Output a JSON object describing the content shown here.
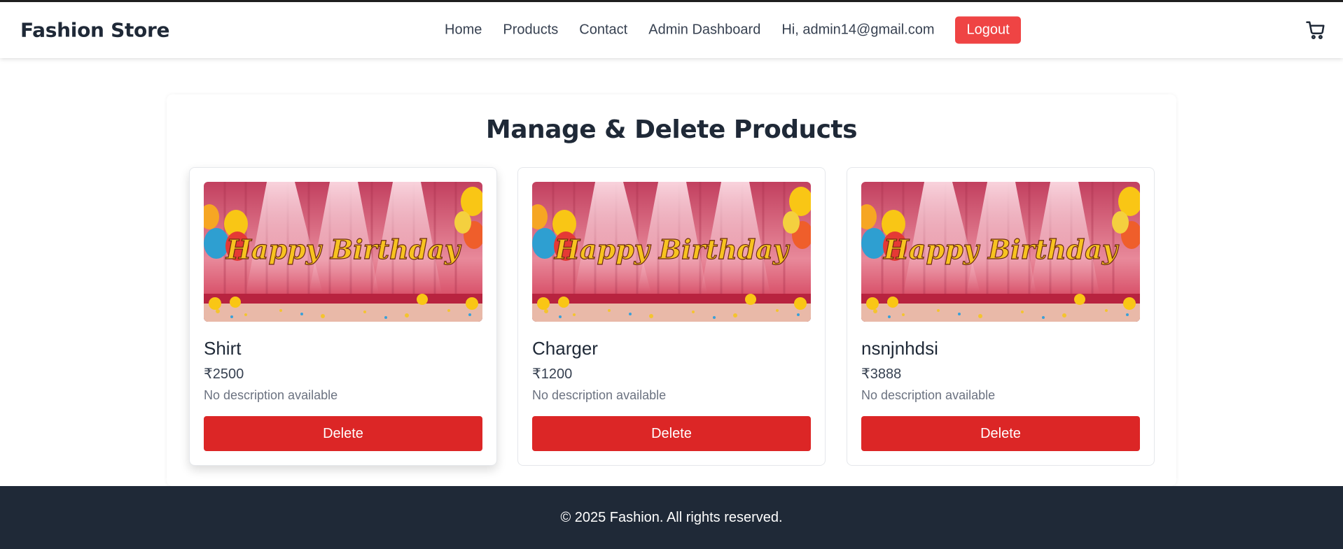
{
  "header": {
    "brand": "Fashion Store",
    "nav": [
      "Home",
      "Products",
      "Contact",
      "Admin Dashboard"
    ],
    "greeting": "Hi, admin14@gmail.com",
    "logout_label": "Logout",
    "cart_icon": "shopping-cart-icon"
  },
  "main": {
    "title": "Manage & Delete Products",
    "products": [
      {
        "name": "Shirt",
        "price": "₹2500",
        "description": "No description available",
        "delete_label": "Delete",
        "image_text": "Happy Birthday"
      },
      {
        "name": "Charger",
        "price": "₹1200",
        "description": "No description available",
        "delete_label": "Delete",
        "image_text": "Happy Birthday"
      },
      {
        "name": "nsnjnhdsi",
        "price": "₹3888",
        "description": "No description available",
        "delete_label": "Delete",
        "image_text": "Happy Birthday"
      }
    ]
  },
  "footer": {
    "text": "© 2025 Fashion. All rights reserved."
  },
  "colors": {
    "accent_red": "#dc2626",
    "logout_red": "#ef4444",
    "footer_bg": "#1f2937",
    "text_dark": "#1f2937"
  }
}
